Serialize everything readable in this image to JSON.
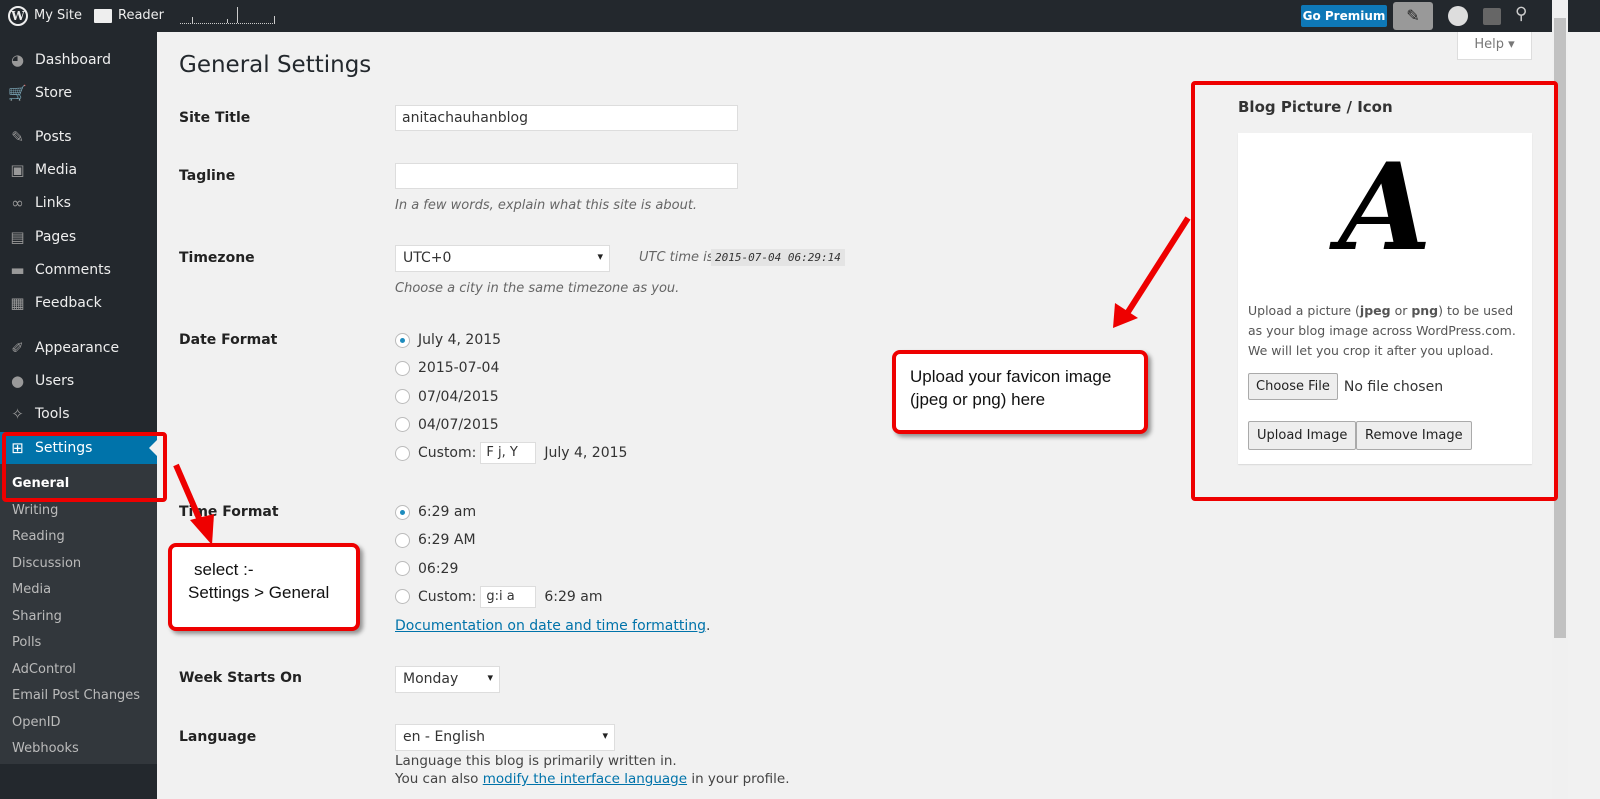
{
  "topbar": {
    "my_site": "My Site",
    "reader": "Reader",
    "go_premium": "Go Premium",
    "icons": [
      "wordpress-logo",
      "reader-icon",
      "new-post-icon",
      "avatar",
      "notifications-icon",
      "search-icon"
    ]
  },
  "help": "Help",
  "sidebar": {
    "items": [
      {
        "label": "Dashboard",
        "icon": "◕"
      },
      {
        "label": "Store",
        "icon": "🛒"
      },
      {
        "label": "Posts",
        "icon": "✎"
      },
      {
        "label": "Media",
        "icon": "▣"
      },
      {
        "label": "Links",
        "icon": "∞"
      },
      {
        "label": "Pages",
        "icon": "▤"
      },
      {
        "label": "Comments",
        "icon": "▬"
      },
      {
        "label": "Feedback",
        "icon": "▦"
      },
      {
        "label": "Appearance",
        "icon": "✐"
      },
      {
        "label": "Users",
        "icon": "●"
      },
      {
        "label": "Tools",
        "icon": "✧"
      },
      {
        "label": "Settings",
        "icon": "⊞"
      }
    ],
    "submenu": [
      "General",
      "Writing",
      "Reading",
      "Discussion",
      "Media",
      "Sharing",
      "Polls",
      "AdControl",
      "Email Post Changes",
      "OpenID",
      "Webhooks"
    ]
  },
  "page": {
    "title": "General Settings",
    "site_title": {
      "label": "Site Title",
      "value": "anitachauhanblog"
    },
    "tagline": {
      "label": "Tagline",
      "value": "",
      "desc": "In a few words, explain what this site is about."
    },
    "timezone": {
      "label": "Timezone",
      "value": "UTC+0",
      "utc_label": "UTC time is",
      "utc_value": "2015-07-04 06:29:14",
      "desc": "Choose a city in the same timezone as you."
    },
    "date_format": {
      "label": "Date Format",
      "options": [
        "July 4, 2015",
        "2015-07-04",
        "07/04/2015",
        "04/07/2015"
      ],
      "custom_label": "Custom:",
      "custom_value": "F j, Y",
      "custom_preview": "July 4, 2015",
      "selected": 0
    },
    "time_format": {
      "label": "Time Format",
      "options": [
        "6:29 am",
        "6:29 AM",
        "06:29"
      ],
      "custom_label": "Custom:",
      "custom_value": "g:i a",
      "custom_preview": "6:29 am",
      "selected": 0,
      "doc_link": "Documentation on date and time formatting",
      "doc_suffix": "."
    },
    "week": {
      "label": "Week Starts On",
      "value": "Monday"
    },
    "language": {
      "label": "Language",
      "value": "en - English",
      "desc1": "Language this blog is primarily written in.",
      "desc2_pre": "You can also ",
      "desc2_link": "modify the interface language",
      "desc2_post": " in your profile."
    }
  },
  "blog_picture": {
    "title": "Blog Picture / Icon",
    "desc_parts": [
      "Upload a picture (",
      "jpeg",
      " or ",
      "png",
      ") to be used as your blog image across WordPress.com. We will let you crop it after you upload."
    ],
    "choose_file": "Choose File",
    "no_file": "No file chosen",
    "upload": "Upload Image",
    "remove": "Remove Image",
    "logo_letter": "A"
  },
  "annotations": {
    "select_line1": "select :-",
    "select_line2": "Settings > General",
    "upload_line1": "Upload your favicon image",
    "upload_line2": "(jpeg or png) here",
    "color": "#e00000"
  }
}
